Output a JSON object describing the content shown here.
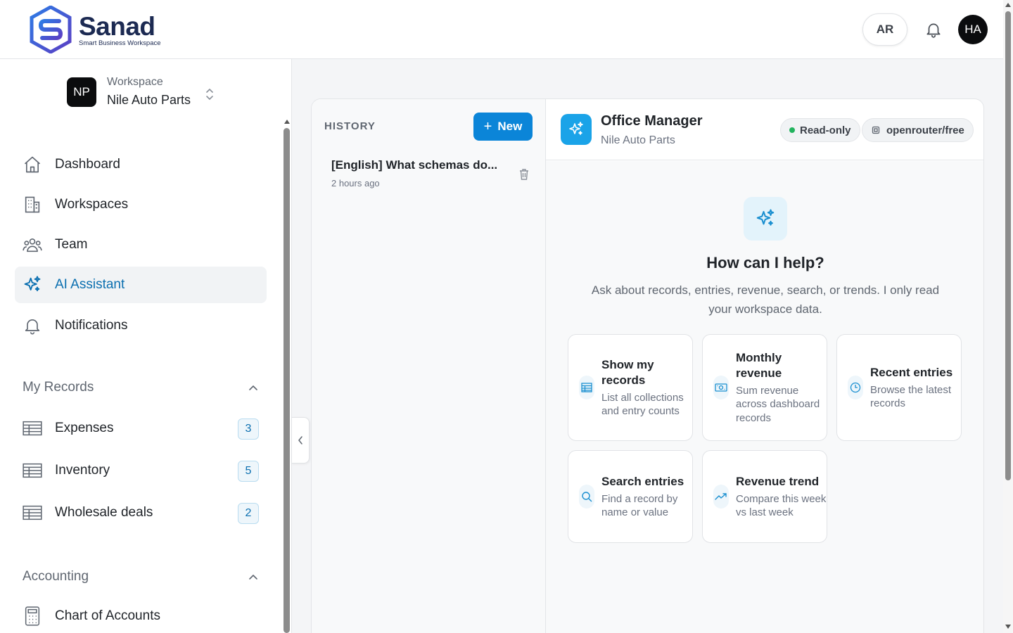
{
  "brand": {
    "name": "Sanad",
    "tagline": "Smart Business Workspace",
    "primary_color": "#1c2a52",
    "accent_color": "#0b85d8"
  },
  "header": {
    "lang_label": "AR",
    "avatar_initials": "HA",
    "notification_icon": "bell-icon"
  },
  "workspace": {
    "label": "Workspace",
    "name": "Nile Auto Parts",
    "initials": "NP"
  },
  "nav": {
    "items": [
      {
        "label": "Dashboard",
        "icon": "home-icon"
      },
      {
        "label": "Workspaces",
        "icon": "building-icon"
      },
      {
        "label": "Team",
        "icon": "users-icon"
      },
      {
        "label": "AI Assistant",
        "icon": "sparkles-icon",
        "active": true
      },
      {
        "label": "Notifications",
        "icon": "bell-icon"
      }
    ]
  },
  "my_records": {
    "title": "My Records",
    "items": [
      {
        "label": "Expenses",
        "count": "3"
      },
      {
        "label": "Inventory",
        "count": "5"
      },
      {
        "label": "Wholesale deals",
        "count": "2"
      }
    ]
  },
  "accounting": {
    "title": "Accounting",
    "items": [
      {
        "label": "Chart of Accounts"
      }
    ]
  },
  "history": {
    "title": "HISTORY",
    "new_label": "New",
    "items": [
      {
        "title": "[English] What schemas do...",
        "time": "2 hours ago"
      }
    ]
  },
  "assistant": {
    "name": "Office Manager",
    "workspace": "Nile Auto Parts",
    "status": "Read-only",
    "model": "openrouter/free"
  },
  "welcome": {
    "title": "How can I help?",
    "subtitle": "Ask about records, entries, revenue, search, or trends. I only read your workspace data."
  },
  "suggestions": [
    {
      "title": "Show my records",
      "desc": "List all collections and entry counts",
      "icon": "table-icon"
    },
    {
      "title": "Monthly revenue",
      "desc": "Sum revenue across dashboard records",
      "icon": "money-icon"
    },
    {
      "title": "Recent entries",
      "desc": "Browse the latest records",
      "icon": "clock-icon"
    },
    {
      "title": "Search entries",
      "desc": "Find a record by name or value",
      "icon": "search-icon"
    },
    {
      "title": "Revenue trend",
      "desc": "Compare this week vs last week",
      "icon": "trend-icon"
    }
  ]
}
